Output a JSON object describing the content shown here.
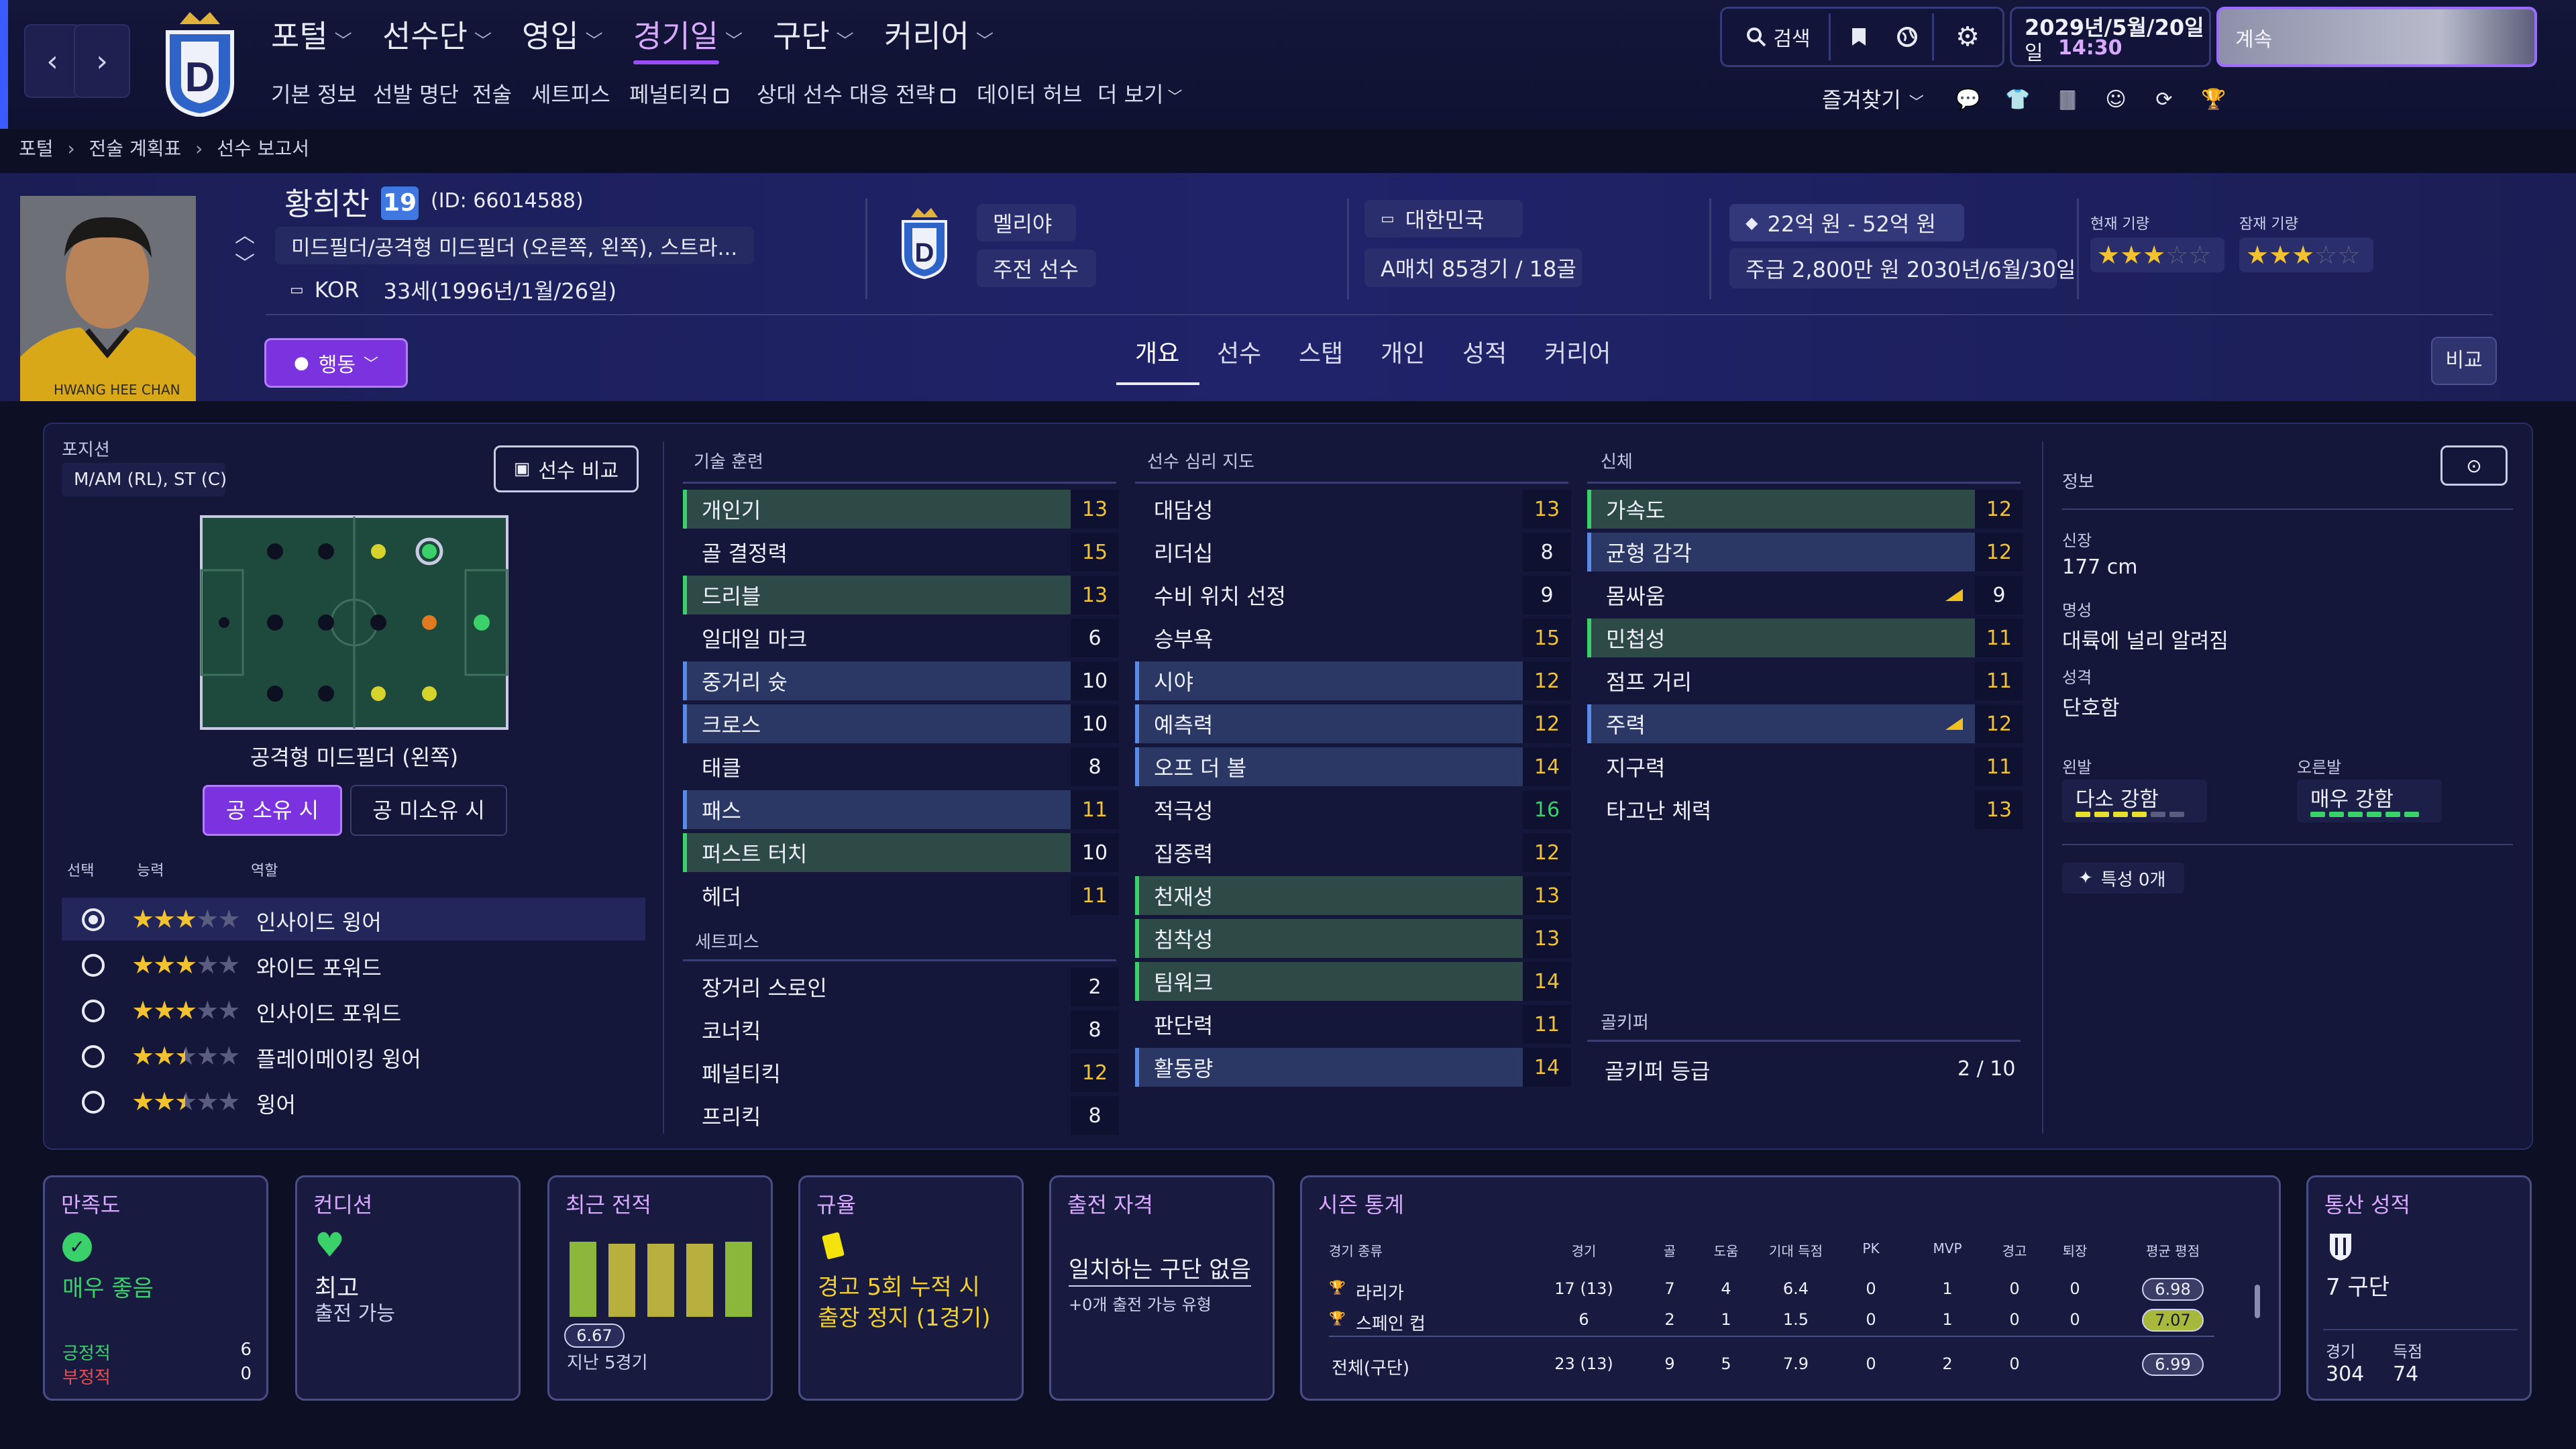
{
  "nav": {
    "back": "‹",
    "forward": "›",
    "menu": [
      {
        "label": "포털"
      },
      {
        "label": "선수단"
      },
      {
        "label": "영입"
      },
      {
        "label": "경기일",
        "active": true
      },
      {
        "label": "구단"
      },
      {
        "label": "커리어"
      }
    ],
    "submenu": [
      "기본 정보",
      "선발 명단",
      "전술",
      "세트피스",
      "페널티킥",
      "상대 선수 대응 전략",
      "데이터 허브",
      "더 보기"
    ],
    "search_label": "검색",
    "favorites_label": "즐겨찾기",
    "date_line1": "2029년/5월/20일",
    "date_day": "일",
    "date_time": "14:30",
    "continue_label": "계속"
  },
  "breadcrumb": [
    "포털",
    "전술 계획표",
    "선수 보고서"
  ],
  "player": {
    "name": "황희찬",
    "number": "19",
    "id_text": "(ID: 66014588)",
    "positions_text": "미드필더/공격형 미드필더 (오른쪽, 왼쪽), 스트라...",
    "nation_code": "KOR",
    "age_text": "33세(1996년/1월/26일)",
    "photo_caption": "HWANG HEE CHAN",
    "action_label": "행동",
    "club": "멜리야",
    "squad_status": "주전 선수",
    "nation": "대한민국",
    "caps_text": "A매치 85경기 / 18골",
    "value_text": "22억 원 - 52억 원",
    "wage_text": "주급 2,800만 원 2030년/6월/30일",
    "current_ability_label": "현재 기량",
    "potential_ability_label": "잠재 기량",
    "current_ability_stars": 3,
    "potential_ability_stars": 3
  },
  "tabs": [
    "개요",
    "선수",
    "스탭",
    "개인",
    "성적",
    "커리어"
  ],
  "compare_label": "비교",
  "position_panel": {
    "title": "포지션",
    "positions": "M/AM (RL), ST (C)",
    "compare_button": "선수 비교",
    "position_name": "공격형 미드필더 (왼쪽)",
    "in_possession": "공 소유 시",
    "out_possession": "공 미소유 시",
    "col_select": "선택",
    "col_ability": "능력",
    "col_role": "역할",
    "roles": [
      {
        "name": "인사이드 윙어",
        "stars": 3,
        "selected": true
      },
      {
        "name": "와이드 포워드",
        "stars": 3,
        "selected": false
      },
      {
        "name": "인사이드 포워드",
        "stars": 3,
        "selected": false
      },
      {
        "name": "플레이메이킹 윙어",
        "stars": 2.5,
        "selected": false
      },
      {
        "name": "윙어",
        "stars": 2.5,
        "selected": false
      }
    ]
  },
  "technical": {
    "title": "기술 훈련",
    "attrs": [
      {
        "name": "개인기",
        "value": "13",
        "hl": "g"
      },
      {
        "name": "골 결정력",
        "value": "15",
        "hl": ""
      },
      {
        "name": "드리블",
        "value": "13",
        "hl": "g"
      },
      {
        "name": "일대일 마크",
        "value": "6",
        "hl": ""
      },
      {
        "name": "중거리 슛",
        "value": "10",
        "hl": "b"
      },
      {
        "name": "크로스",
        "value": "10",
        "hl": "b"
      },
      {
        "name": "태클",
        "value": "8",
        "hl": ""
      },
      {
        "name": "패스",
        "value": "11",
        "hl": "b"
      },
      {
        "name": "퍼스트 터치",
        "value": "10",
        "hl": "g"
      },
      {
        "name": "헤더",
        "value": "11",
        "hl": ""
      }
    ],
    "setpiece_title": "세트피스",
    "setpieces": [
      {
        "name": "장거리 스로인",
        "value": "2",
        "hl": ""
      },
      {
        "name": "코너킥",
        "value": "8",
        "hl": ""
      },
      {
        "name": "페널티킥",
        "value": "12",
        "hl": ""
      },
      {
        "name": "프리킥",
        "value": "8",
        "hl": ""
      }
    ]
  },
  "mental": {
    "title": "선수 심리 지도",
    "attrs": [
      {
        "name": "대담성",
        "value": "13",
        "hl": ""
      },
      {
        "name": "리더십",
        "value": "8",
        "hl": ""
      },
      {
        "name": "수비 위치 선정",
        "value": "9",
        "hl": ""
      },
      {
        "name": "승부욕",
        "value": "15",
        "hl": ""
      },
      {
        "name": "시야",
        "value": "12",
        "hl": "b"
      },
      {
        "name": "예측력",
        "value": "12",
        "hl": "b"
      },
      {
        "name": "오프 더 볼",
        "value": "14",
        "hl": "b"
      },
      {
        "name": "적극성",
        "value": "16",
        "hl": ""
      },
      {
        "name": "집중력",
        "value": "12",
        "hl": ""
      },
      {
        "name": "천재성",
        "value": "13",
        "hl": "g"
      },
      {
        "name": "침착성",
        "value": "13",
        "hl": "g"
      },
      {
        "name": "팀워크",
        "value": "14",
        "hl": "g"
      },
      {
        "name": "판단력",
        "value": "11",
        "hl": ""
      },
      {
        "name": "활동량",
        "value": "14",
        "hl": "b"
      }
    ]
  },
  "physical": {
    "title": "신체",
    "attrs": [
      {
        "name": "가속도",
        "value": "12",
        "hl": "g"
      },
      {
        "name": "균형 감각",
        "value": "12",
        "hl": "b"
      },
      {
        "name": "몸싸움",
        "value": "9",
        "hl": "",
        "trend": true
      },
      {
        "name": "민첩성",
        "value": "11",
        "hl": "g"
      },
      {
        "name": "점프 거리",
        "value": "11",
        "hl": ""
      },
      {
        "name": "주력",
        "value": "12",
        "hl": "b",
        "trend": true
      },
      {
        "name": "지구력",
        "value": "11",
        "hl": ""
      },
      {
        "name": "타고난 체력",
        "value": "13",
        "hl": ""
      }
    ],
    "gk_title": "골키퍼",
    "gk_label": "골키퍼 등급",
    "gk_value": "2 / 10"
  },
  "info": {
    "title": "정보",
    "height_label": "신장",
    "height": "177 cm",
    "fame_label": "명성",
    "fame": "대륙에 널리 알려짐",
    "personality_label": "성격",
    "personality": "단호함",
    "left_foot_label": "왼발",
    "left_foot": "다소 강함",
    "right_foot_label": "오른발",
    "right_foot": "매우 강함",
    "left_foot_level": 4,
    "right_foot_level": 6,
    "traits_label": "특성 0개"
  },
  "cards": {
    "morale": {
      "title": "만족도",
      "value": "매우 좋음",
      "pos_label": "긍정적",
      "pos_value": "6",
      "neg_label": "부정적",
      "neg_value": "0"
    },
    "condition": {
      "title": "컨디션",
      "value": "최고",
      "sub": "출전 가능"
    },
    "form": {
      "title": "최근 전적",
      "rating": "6.67",
      "sub": "지난 5경기",
      "bars": [
        0.95,
        0.92,
        0.92,
        0.92,
        0.95
      ]
    },
    "discipline": {
      "title": "규율",
      "line1": "경고 5회 누적 시",
      "line2": "출장 정지 (1경기)"
    },
    "eligibility": {
      "title": "출전 자격",
      "value": "일치하는 구단 없음",
      "sub": "+0개 출전 가능 유형"
    },
    "season": {
      "title": "시즌 통계",
      "headers": [
        "경기 종류",
        "경기",
        "골",
        "도움",
        "기대 득점",
        "PK",
        "MVP",
        "경고",
        "퇴장",
        "평균 평점"
      ],
      "rows": [
        {
          "comp": "라리가",
          "apps": "17 (13)",
          "goals": "7",
          "assists": "4",
          "xg": "6.4",
          "pk": "0",
          "mvp": "1",
          "yel": "0",
          "red": "0",
          "rating": "6.98"
        },
        {
          "comp": "스페인 컵",
          "apps": "6",
          "goals": "2",
          "assists": "1",
          "xg": "1.5",
          "pk": "0",
          "mvp": "1",
          "yel": "0",
          "red": "0",
          "rating": "7.07"
        }
      ],
      "total": {
        "comp": "전체(구단)",
        "apps": "23 (13)",
        "goals": "9",
        "assists": "5",
        "xg": "7.9",
        "pk": "0",
        "mvp": "2",
        "yel": "0",
        "red": "",
        "rating": "6.99"
      }
    },
    "career": {
      "title": "통산 성적",
      "clubs": "7 구단",
      "apps_label": "경기",
      "apps": "304",
      "goals_label": "득점",
      "goals": "74"
    }
  },
  "colors": {
    "accent": "#9a4dff",
    "good": "#3ad06a",
    "star": "#f2c230",
    "highlight_green": "#2e4a47",
    "highlight_blue": "#2b3866"
  }
}
